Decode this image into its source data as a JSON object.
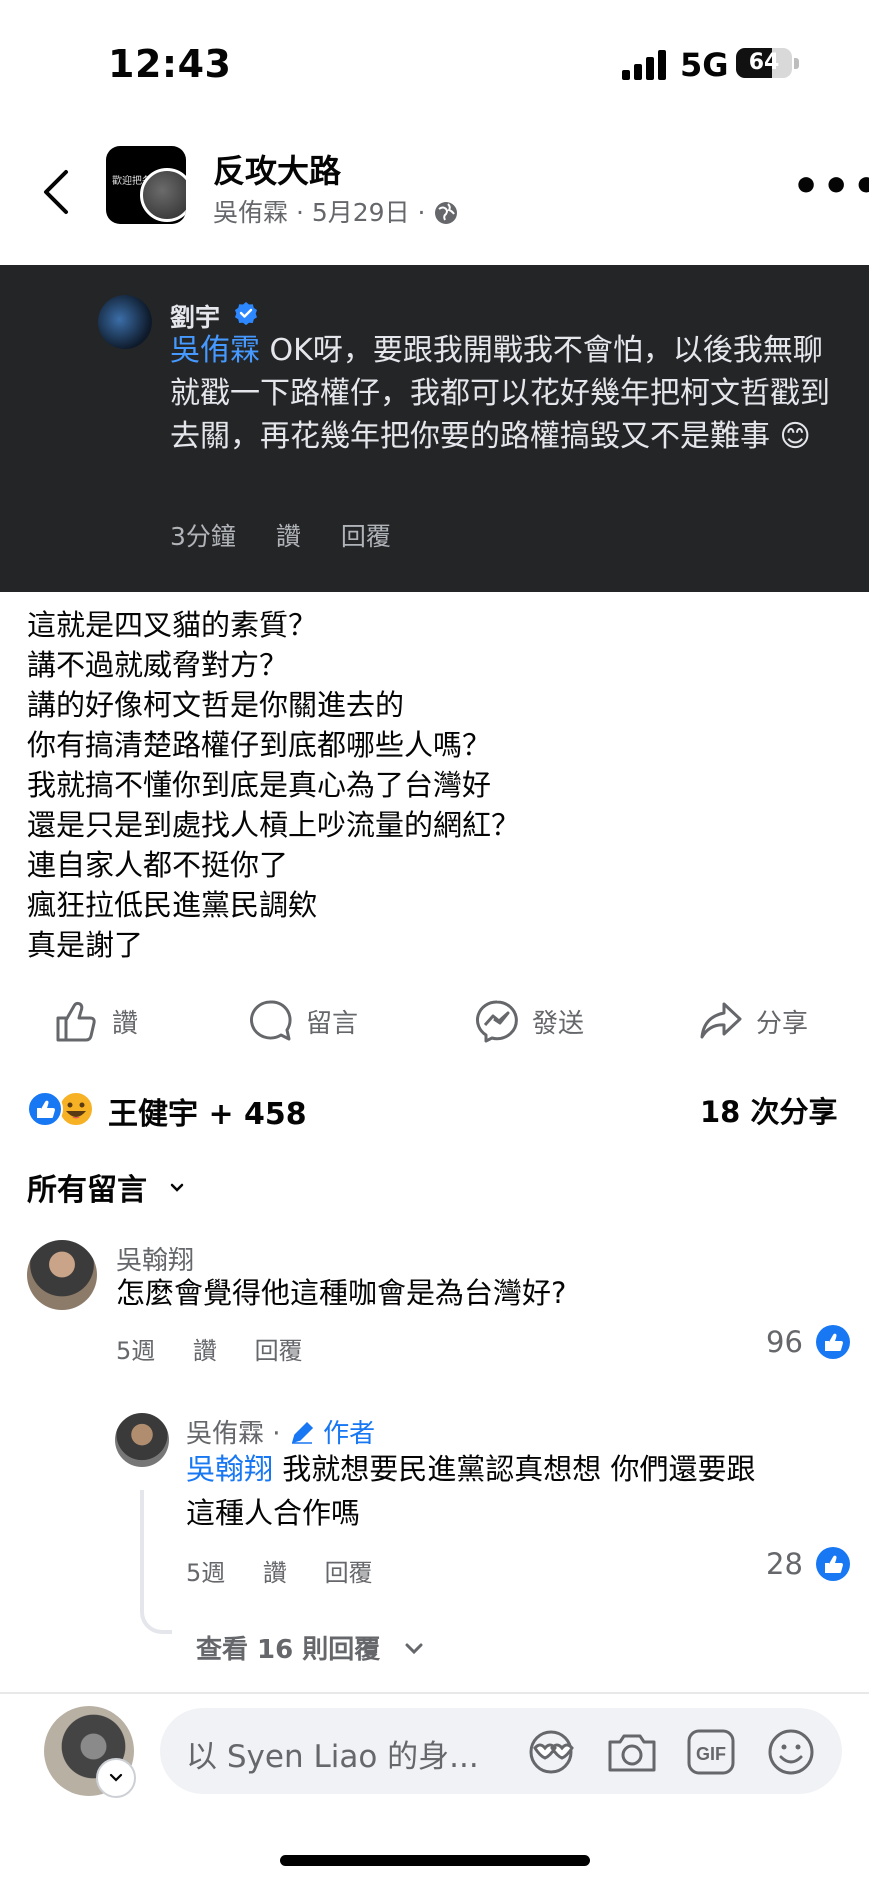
{
  "status_bar": {
    "time": "12:43",
    "network": "5G",
    "battery": "64",
    "battery_level": 0.64
  },
  "header": {
    "group_name": "反攻大路",
    "author": "吳侑霖",
    "date": "5月29日",
    "sep": "·",
    "thumb_caption": "歡迎把各種"
  },
  "embedded_comment": {
    "name": "劉宇",
    "mention": "吳侑霖",
    "text": " OK呀，要跟我開戰我不會怕，以後我無聊就戳一下路權仔，我都可以花好幾年把柯文哲戳到去關，再花幾年把你要的路權搞毀又不是難事 😊",
    "time": "3分鐘",
    "like": "讚",
    "reply": "回覆"
  },
  "post_lines": [
    "這就是四叉貓的素質？",
    "講不過就威脅對方？",
    "講的好像柯文哲是你關進去的",
    "你有搞清楚路權仔到底都哪些人嗎？",
    "我就搞不懂你到底是真心為了台灣好",
    "還是只是到處找人槓上吵流量的網紅？",
    "連自家人都不挺你了",
    "瘋狂拉低民進黨民調欸",
    "真是謝了"
  ],
  "actions": {
    "like": "讚",
    "comment": "留言",
    "send": "發送",
    "share": "分享"
  },
  "reactions": {
    "names": "王健宇 + 458",
    "shares": "18 次分享"
  },
  "comments_filter": "所有留言",
  "comments": [
    {
      "name": "吳翰翔",
      "text": "怎麼會覺得他這種咖會是為台灣好?",
      "time": "5週",
      "like": "讚",
      "reply": "回覆",
      "count": "96"
    }
  ],
  "reply": {
    "name": "吳侑霖",
    "sep": "·",
    "badge": "作者",
    "mention": "吳翰翔",
    "line1": " 我就想要民進黨認真想想 你們還要跟",
    "line2": "這種人合作嗎",
    "time": "5週",
    "like": "讚",
    "reply": "回覆",
    "count": "28"
  },
  "view_replies": "查看 16 則回覆",
  "composer": {
    "placeholder": "以 Syen  Liao 的身..."
  },
  "colors": {
    "accent": "#1877f2",
    "dark_bg": "#242526",
    "muted": "#65676b"
  }
}
